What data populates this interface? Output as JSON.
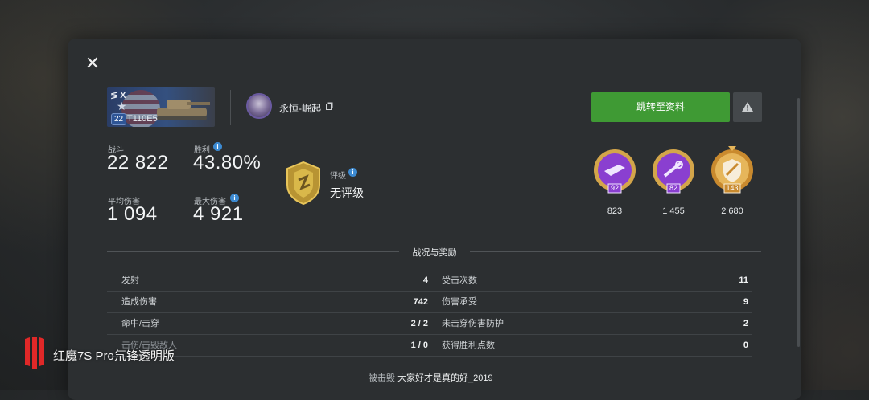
{
  "tank": {
    "tier": "X",
    "level": "22",
    "name": "T110E5"
  },
  "player": {
    "name": "永恒-崛起"
  },
  "buttons": {
    "goto_profile": "跳转至资料"
  },
  "stats": {
    "battles_label": "战斗",
    "battles_value": "22 822",
    "winrate_label": "胜利",
    "winrate_value": "43.80%",
    "avg_damage_label": "平均伤害",
    "avg_damage_value": "1 094",
    "max_damage_label": "最大伤害",
    "max_damage_value": "4 921",
    "rating_label": "评级",
    "rating_value": "无评级"
  },
  "medals": [
    {
      "level": "92",
      "count": "823",
      "color": "#8a3fd0"
    },
    {
      "level": "82",
      "count": "1 455",
      "color": "#8a3fd0"
    },
    {
      "level": "143",
      "count": "2 680",
      "color": "#d89a3a"
    }
  ],
  "section_title": "战况与奖励",
  "left_rows": [
    {
      "label": "发射",
      "value": "4"
    },
    {
      "label": "造成伤害",
      "value": "742"
    },
    {
      "label": "命中/击穿",
      "value": "2 / 2"
    },
    {
      "label": "击伤/击毁敌人",
      "value": "1 / 0"
    }
  ],
  "right_rows": [
    {
      "label": "受击次数",
      "value": "11"
    },
    {
      "label": "伤害承受",
      "value": "9"
    },
    {
      "label": "未击穿伤害防护",
      "value": "2"
    },
    {
      "label": "获得胜利点数",
      "value": "0"
    }
  ],
  "destroyed_by": {
    "prefix": "被击毁",
    "name": "大家好才是真的好_2019"
  },
  "watermark": "红魔7S Pro氘锋透明版",
  "colors": {
    "accent_green": "#3f9a34",
    "info_blue": "#3c8ad1",
    "panel": "#2c2f31"
  }
}
